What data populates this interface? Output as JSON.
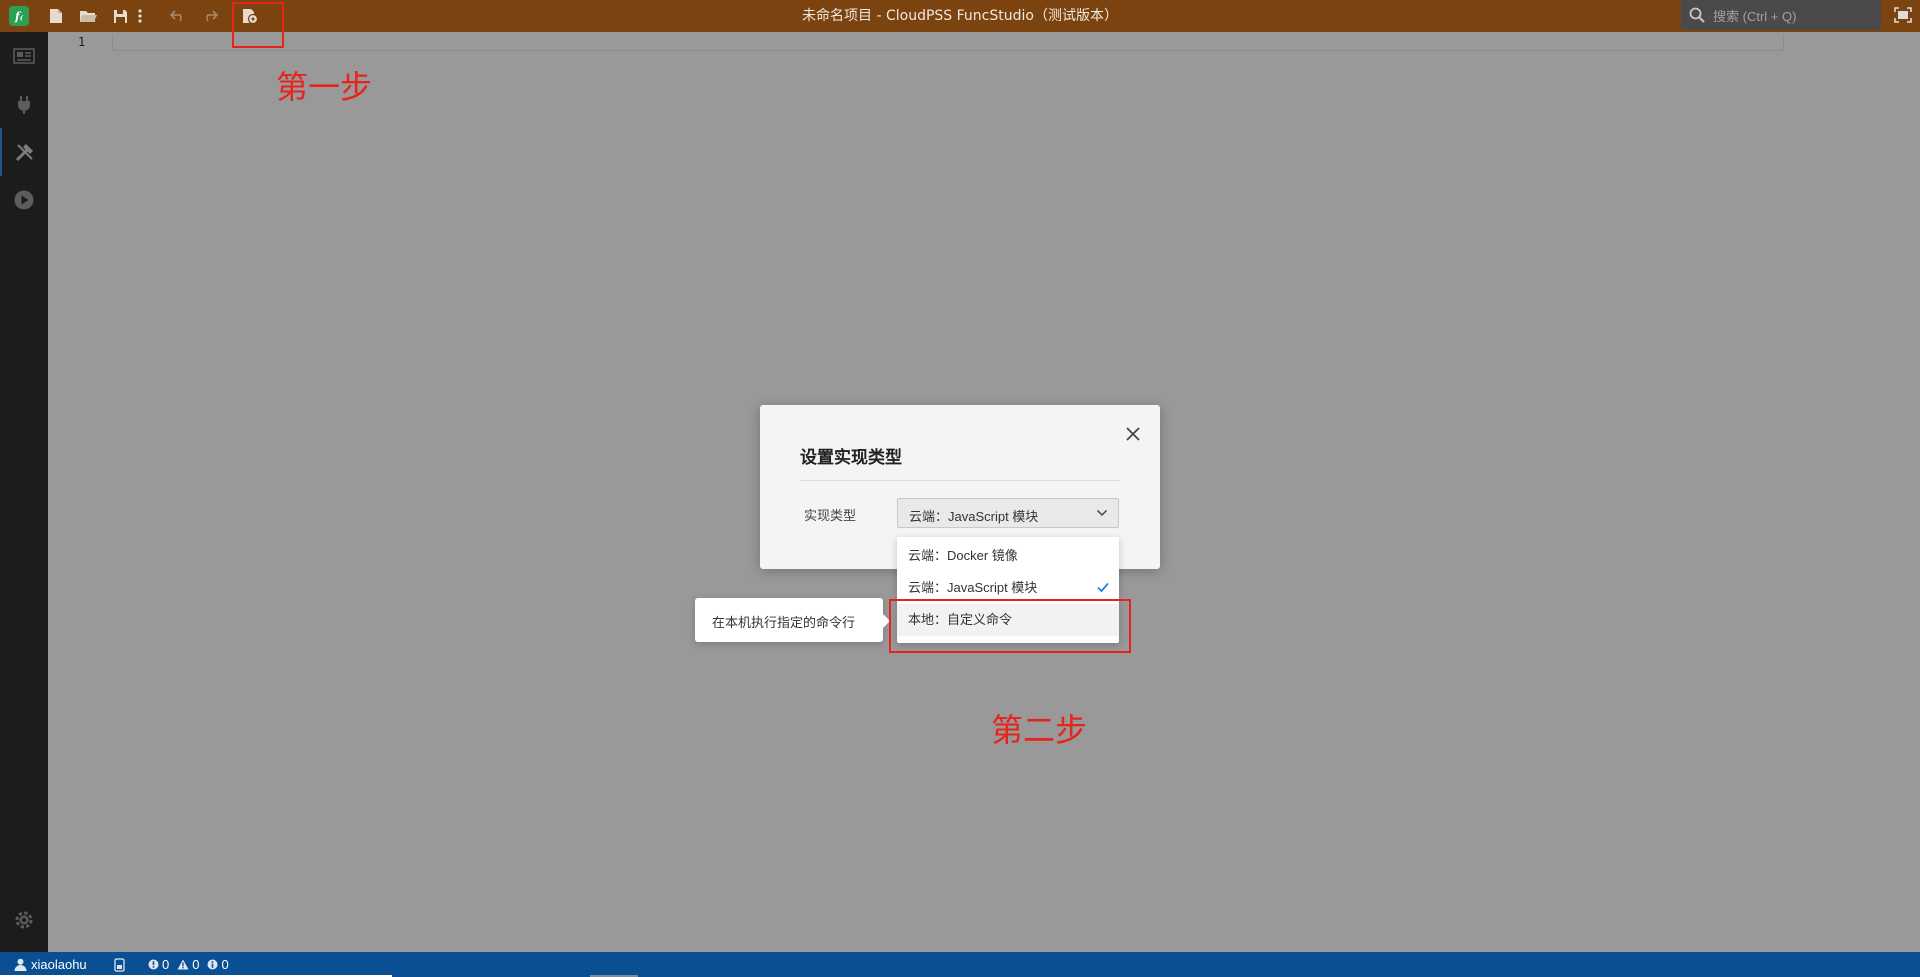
{
  "window": {
    "title": "未命名项目 - CloudPSS FuncStudio（测试版本）",
    "logo_text": "f₍"
  },
  "toolbar": {
    "icons": [
      "new-file-icon",
      "open-folder-icon",
      "save-icon",
      "more-icon",
      "undo-icon",
      "redo-icon",
      "implementation-type-icon"
    ]
  },
  "search": {
    "placeholder": "搜索 (Ctrl + Q)"
  },
  "activitybar": {
    "items": [
      "document-icon",
      "plug-icon",
      "tools-icon",
      "run-icon"
    ],
    "active_index": 2,
    "settings": "gear-icon"
  },
  "editor": {
    "line_number": "1"
  },
  "dialog": {
    "title": "设置实现类型",
    "field_label": "实现类型",
    "selected_value": "云端：JavaScript 模块"
  },
  "dropdown": {
    "options": [
      {
        "label": "云端：Docker 镜像",
        "selected": false
      },
      {
        "label": "云端：JavaScript 模块",
        "selected": true
      },
      {
        "label": "本地：自定义命令",
        "selected": false
      }
    ],
    "hovered_index": 2
  },
  "tooltip": {
    "text": "在本机执行指定的命令行"
  },
  "annotations": {
    "step1": "第一步",
    "step2": "第二步",
    "color": "#e8231c"
  },
  "statusbar": {
    "username": "xiaolaohu",
    "errors": "0",
    "warnings": "0",
    "infos": "0",
    "background": "#0b4f93"
  }
}
